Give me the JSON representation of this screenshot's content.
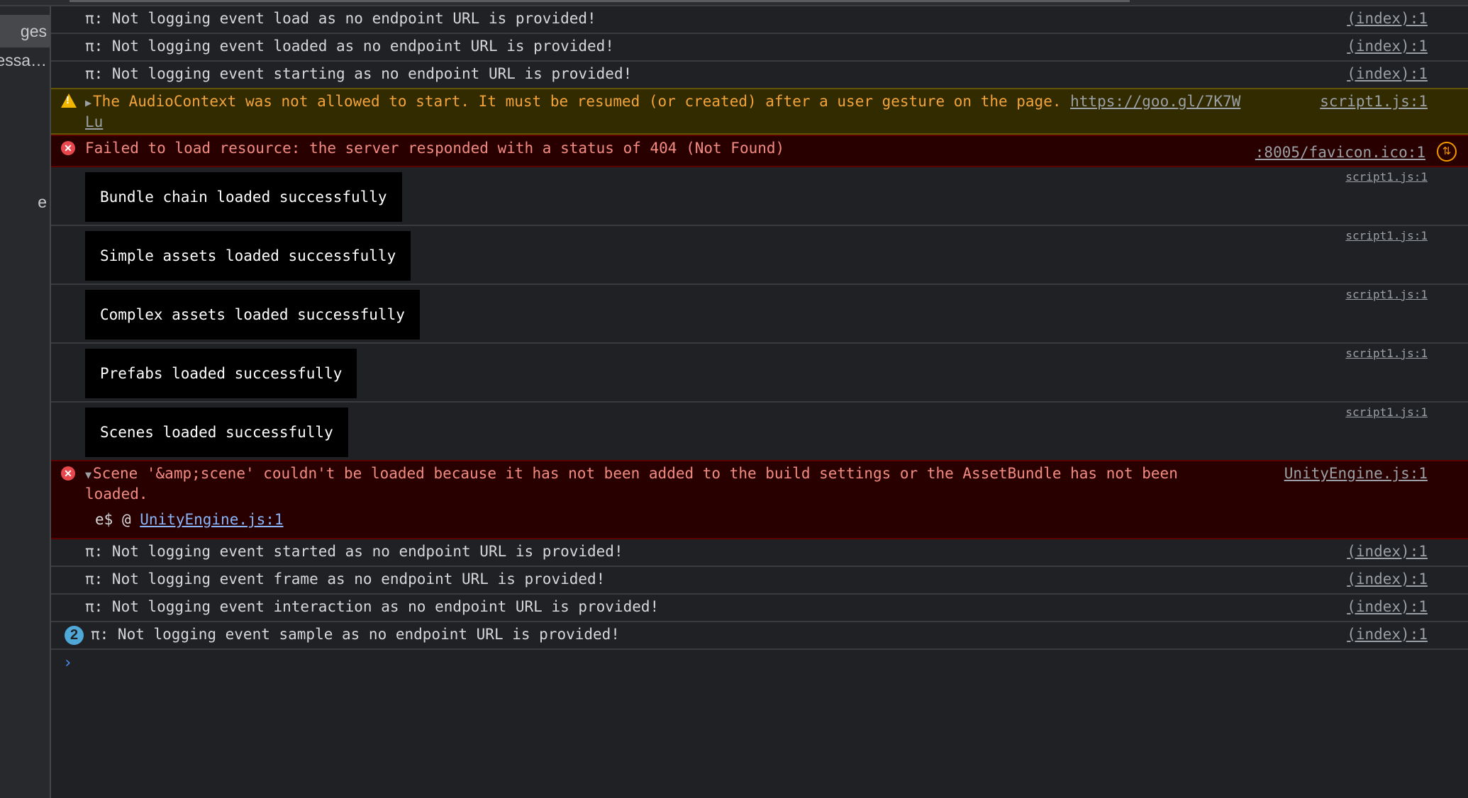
{
  "sidebar": {
    "items": [
      {
        "label": "ges",
        "active": true
      },
      {
        "label": "essa…",
        "active": false
      },
      {
        "label": "e",
        "active": false
      }
    ]
  },
  "console": {
    "rows": [
      {
        "type": "info",
        "text": "π: Not logging event load as no endpoint URL is provided!",
        "source": "(index):1"
      },
      {
        "type": "info",
        "text": "π: Not logging event loaded as no endpoint URL is provided!",
        "source": "(index):1"
      },
      {
        "type": "info",
        "text": "π: Not logging event starting as no endpoint URL is provided!",
        "source": "(index):1"
      },
      {
        "type": "warning",
        "text": "The AudioContext was not allowed to start. It must be resumed (or created) after a user gesture on the page.",
        "link": "https://goo.gl/7K7W",
        "link_wrap": "Lu",
        "source": "script1.js:1"
      },
      {
        "type": "error",
        "text": "Failed to load resource: the server responded with a status of 404 (Not Found)",
        "source": ":8005/favicon.ico:1"
      },
      {
        "type": "box",
        "text": "Bundle chain loaded successfully",
        "source": "script1.js:1"
      },
      {
        "type": "box",
        "text": "Simple assets loaded successfully",
        "source": "script1.js:1"
      },
      {
        "type": "box",
        "text": "Complex assets loaded successfully",
        "source": "script1.js:1"
      },
      {
        "type": "box",
        "text": "Prefabs loaded successfully",
        "source": "script1.js:1"
      },
      {
        "type": "box",
        "text": "Scenes loaded successfully",
        "source": "script1.js:1"
      },
      {
        "type": "error-expanded",
        "text": "Scene '&amp;scene' couldn't be loaded because it has not been added to the build settings or the AssetBundle has not been",
        "text_wrap": "loaded.",
        "stack_fn": "e$",
        "stack_at": "@",
        "stack_link": "UnityEngine.js:1",
        "source": "UnityEngine.js:1"
      },
      {
        "type": "info",
        "text": "π: Not logging event started as no endpoint URL is provided!",
        "source": "(index):1"
      },
      {
        "type": "info",
        "text": "π: Not logging event frame as no endpoint URL is provided!",
        "source": "(index):1"
      },
      {
        "type": "info",
        "text": "π: Not logging event interaction as no endpoint URL is provided!",
        "source": "(index):1"
      },
      {
        "type": "info-repeat",
        "count": "2",
        "text": "π: Not logging event sample as no endpoint URL is provided!",
        "source": "(index):1"
      }
    ],
    "prompt": "›"
  },
  "icons": {
    "warning": "warning-triangle-icon",
    "error": "error-circle-icon",
    "network": "network-request-icon",
    "expand": "▶",
    "collapse": "▼"
  },
  "colors": {
    "background": "#202124",
    "warning_bg": "#332b00",
    "warning_text": "#f2a33a",
    "error_bg": "#290000",
    "error_text": "#f28b82",
    "link": "#8ab4f8",
    "badge": "#4fa8d8"
  }
}
